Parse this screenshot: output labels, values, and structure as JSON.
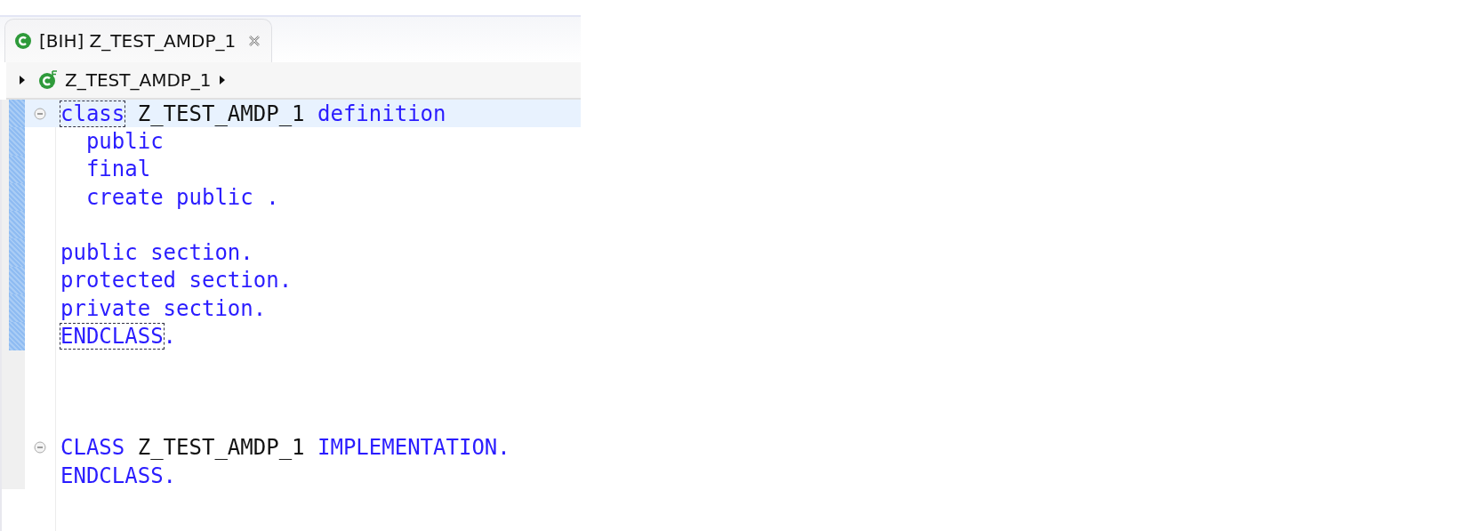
{
  "tabs": [
    {
      "label": "[BIH] Z_TEST_AMDP_1",
      "selected": true
    }
  ],
  "breadcrumb": {
    "label": "Z_TEST_AMDP_1"
  },
  "lines": [
    {
      "kind": "code",
      "current": true,
      "changed": true,
      "expanded": true,
      "tokens": [
        {
          "text": "class",
          "kind": "matched"
        },
        {
          "text": " Z_TEST_AMDP_1 ",
          "kind": "identifier"
        },
        {
          "text": "definition",
          "kind": "keyword"
        }
      ]
    },
    {
      "kind": "code",
      "current": false,
      "changed": true,
      "tokens": [
        {
          "text": "  public",
          "kind": "keyword"
        }
      ]
    },
    {
      "kind": "code",
      "current": false,
      "changed": true,
      "tokens": [
        {
          "text": "  final",
          "kind": "keyword"
        }
      ]
    },
    {
      "kind": "code",
      "current": false,
      "changed": true,
      "tokens": [
        {
          "text": "  create public .",
          "kind": "keyword"
        }
      ]
    },
    {
      "kind": "blank",
      "current": false,
      "changed": true
    },
    {
      "kind": "code",
      "current": false,
      "changed": true,
      "tokens": [
        {
          "text": "public section.",
          "kind": "keyword"
        }
      ]
    },
    {
      "kind": "code",
      "current": false,
      "changed": true,
      "tokens": [
        {
          "text": "protected section.",
          "kind": "keyword"
        }
      ]
    },
    {
      "kind": "code",
      "current": false,
      "changed": true,
      "tokens": [
        {
          "text": "private section.",
          "kind": "keyword"
        }
      ]
    },
    {
      "kind": "code",
      "current": false,
      "changed": true,
      "tokens": [
        {
          "text": "ENDCLASS",
          "kind": "matched"
        },
        {
          "text": ".",
          "kind": "keyword"
        }
      ]
    },
    {
      "kind": "blank",
      "current": false,
      "changed": false
    },
    {
      "kind": "blank",
      "current": false,
      "changed": false
    },
    {
      "kind": "blank",
      "current": false,
      "changed": false
    },
    {
      "kind": "code",
      "current": false,
      "changed": false,
      "expanded": true,
      "tokens": [
        {
          "text": "CLASS",
          "kind": "keyword"
        },
        {
          "text": " Z_TEST_AMDP_1 ",
          "kind": "identifier"
        },
        {
          "text": "IMPLEMENTATION.",
          "kind": "keyword"
        }
      ]
    },
    {
      "kind": "code",
      "current": false,
      "changed": false,
      "tokens": [
        {
          "text": "ENDCLASS.",
          "kind": "keyword"
        }
      ]
    }
  ]
}
